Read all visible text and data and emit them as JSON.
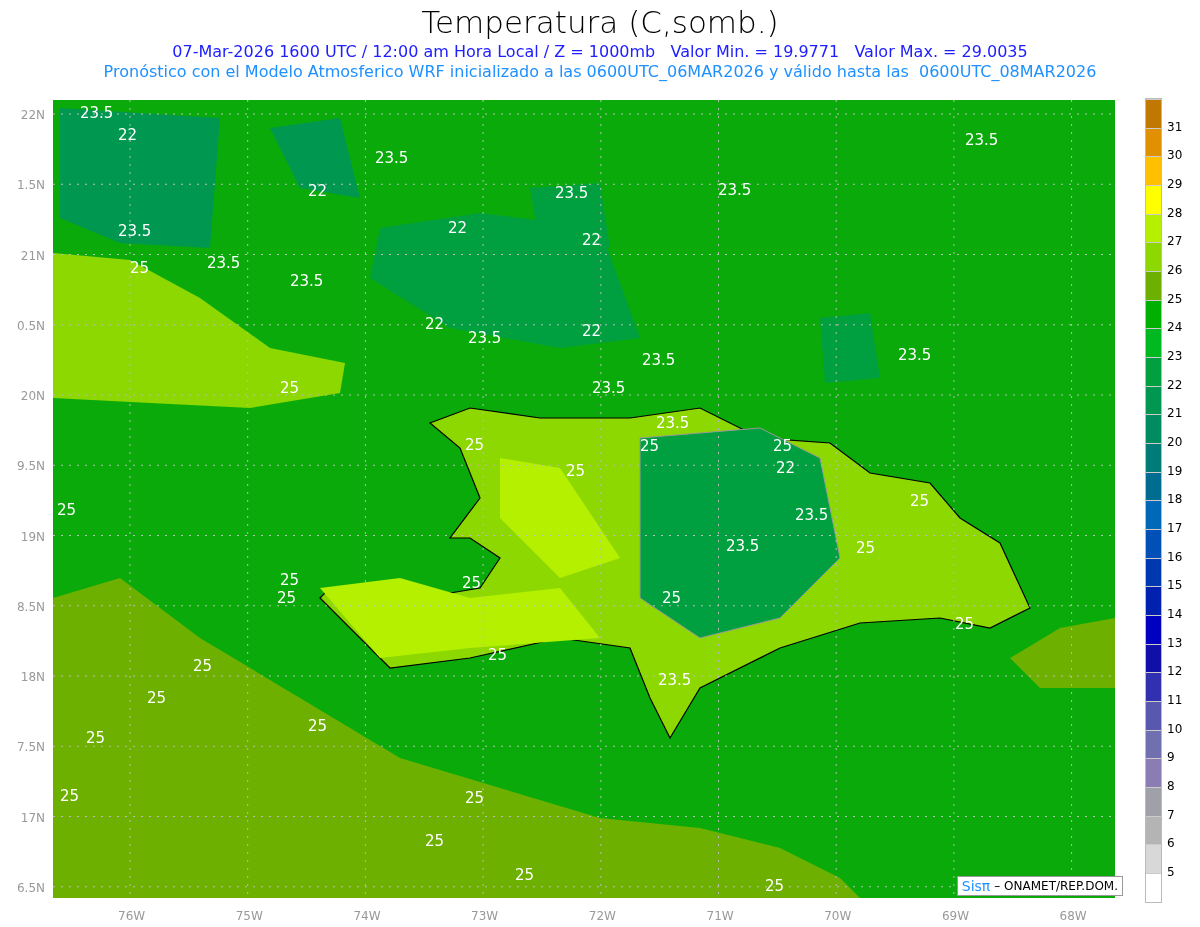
{
  "title": "Temperatura (C,somb.)",
  "subtitle": "07-Mar-2026 1600 UTC / 12:00 am Hora Local / Z = 1000mb   Valor Min. = 19.9771   Valor Max. = 29.0035",
  "description": "Pronóstico con el Modelo Atmosferico WRF inicializado a las 0600UTC_06MAR2026 y válido hasta las  0600UTC_08MAR2026",
  "lat_labels": [
    "22N",
    "1.5N",
    "21N",
    "0.5N",
    "20N",
    "9.5N",
    "19N",
    "8.5N",
    "18N",
    "7.5N",
    "17N",
    "6.5N"
  ],
  "lon_labels": [
    "76W",
    "75W",
    "74W",
    "73W",
    "72W",
    "71W",
    "70W",
    "69W",
    "68W"
  ],
  "contour_labels": [
    "23.5",
    "22",
    "23.5",
    "22",
    "23.5",
    "23.5",
    "23.5",
    "22",
    "22",
    "23.5",
    "25",
    "23.5",
    "23.5",
    "22",
    "23.5",
    "22",
    "23.5",
    "23.5",
    "23.5",
    "25",
    "23.5",
    "25",
    "25",
    "25",
    "25",
    "22",
    "25",
    "23.5",
    "25",
    "23.5",
    "25",
    "25",
    "25",
    "25",
    "25",
    "25",
    "25",
    "25",
    "23.5",
    "25",
    "25",
    "25",
    "25",
    "25",
    "25",
    "25",
    "25"
  ],
  "colorbar": {
    "swatches": [
      {
        "color": "#c07800"
      },
      {
        "color": "#e09000"
      },
      {
        "color": "#ffc000"
      },
      {
        "color": "#ffff00"
      },
      {
        "color": "#b4f000"
      },
      {
        "color": "#8cd800"
      },
      {
        "color": "#6eb000"
      },
      {
        "color": "#00b000"
      },
      {
        "color": "#00b820"
      },
      {
        "color": "#00a040"
      },
      {
        "color": "#009850"
      },
      {
        "color": "#008c60"
      },
      {
        "color": "#007c78"
      },
      {
        "color": "#006c90"
      },
      {
        "color": "#0068b8"
      },
      {
        "color": "#0050b8"
      },
      {
        "color": "#0038b0"
      },
      {
        "color": "#0020b0"
      },
      {
        "color": "#0000c0"
      },
      {
        "color": "#1010a8"
      },
      {
        "color": "#3030b0"
      },
      {
        "color": "#5858b0"
      },
      {
        "color": "#7070b0"
      },
      {
        "color": "#8c7cb4"
      },
      {
        "color": "#a0a0a8"
      },
      {
        "color": "#b4b4b4"
      },
      {
        "color": "#d8d8d8"
      },
      {
        "color": "#ffffff"
      }
    ],
    "labels": [
      "31",
      "30",
      "29",
      "28",
      "27",
      "26",
      "25",
      "24",
      "23",
      "22",
      "21",
      "20",
      "19",
      "18",
      "17",
      "16",
      "15",
      "14",
      "13",
      "12",
      "11",
      "10",
      "9",
      "8",
      "7",
      "6",
      "5"
    ]
  },
  "credit": {
    "logo": "Sisπ",
    "text": "– ONAMET/REP.DOM."
  }
}
